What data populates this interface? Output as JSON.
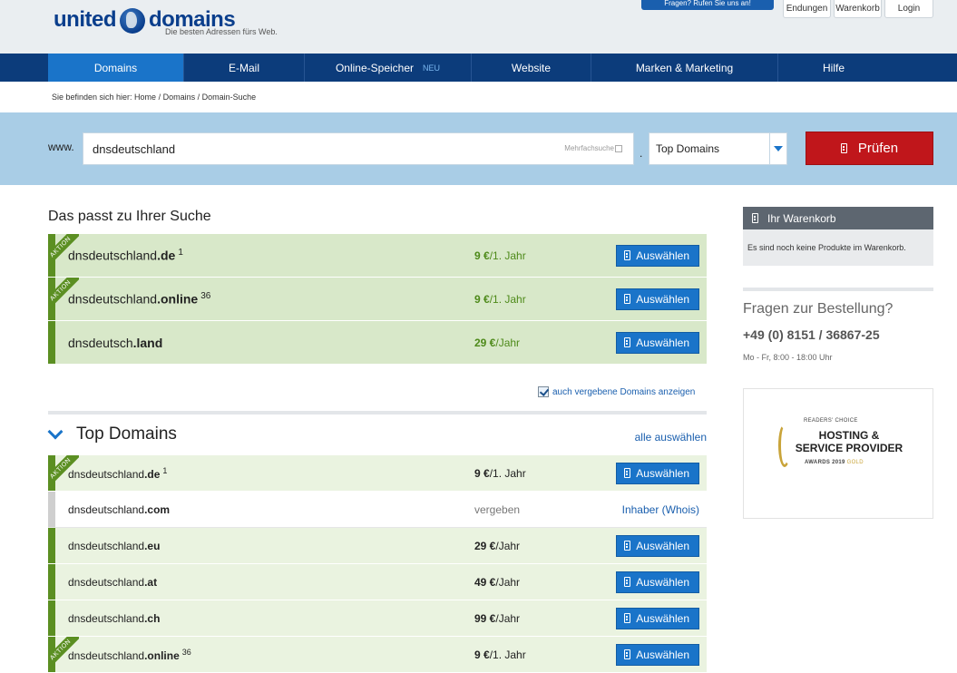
{
  "header": {
    "logo_left": "united",
    "logo_right": "domains",
    "tagline": "Die besten Adressen fürs Web.",
    "promo_text": "Fragen? Rufen Sie uns an!",
    "buttons": {
      "endungen": "Endungen",
      "warenkorb": "Warenkorb",
      "login": "Login"
    }
  },
  "nav": {
    "items": [
      {
        "label": "Domains"
      },
      {
        "label": "E-Mail"
      },
      {
        "label": "Online-Speicher",
        "badge": "NEU"
      },
      {
        "label": "Website"
      },
      {
        "label": "Marken & Marketing"
      },
      {
        "label": "Hilfe"
      }
    ]
  },
  "breadcrumb": "Sie befinden sich hier: Home / Domains / Domain-Suche",
  "search": {
    "prefix": "www.",
    "value": "dnsdeutschland",
    "multi_label": "Mehrfachsuche",
    "dot": ".",
    "tld_select": "Top Domains",
    "submit_label": "Prüfen"
  },
  "matches": {
    "heading": "Das passt zu Ihrer Suche",
    "aktion_label": "AKTION",
    "select_label": "Auswählen",
    "rows": [
      {
        "sld": "dnsdeutschland",
        "tld": ".de",
        "note": "1",
        "price": "9 €",
        "unit": "/1. Jahr"
      },
      {
        "sld": "dnsdeutschland",
        "tld": ".online",
        "note": "36",
        "price": "9 €",
        "unit": "/1. Jahr"
      },
      {
        "sld": "dnsdeutsch",
        "tld": ".land",
        "note": "",
        "price": "29 €",
        "unit": "/Jahr"
      }
    ]
  },
  "show_taken_label": "auch vergebene Domains anzeigen",
  "top_domains": {
    "title": "Top Domains",
    "select_all": "alle auswählen",
    "select_label": "Auswählen",
    "whois_label": "Inhaber (Whois)",
    "rows": [
      {
        "sld": "dnsdeutschland",
        "tld": ".de",
        "note": "1",
        "price": "9 €",
        "unit": "/1. Jahr"
      },
      {
        "sld": "dnsdeutschland",
        "tld": ".com",
        "note": "",
        "status": "vergeben"
      },
      {
        "sld": "dnsdeutschland",
        "tld": ".eu",
        "note": "",
        "price": "29 €",
        "unit": "/Jahr"
      },
      {
        "sld": "dnsdeutschland",
        "tld": ".at",
        "note": "",
        "price": "49 €",
        "unit": "/Jahr"
      },
      {
        "sld": "dnsdeutschland",
        "tld": ".ch",
        "note": "",
        "price": "99 €",
        "unit": "/Jahr"
      },
      {
        "sld": "dnsdeutschland",
        "tld": ".online",
        "note": "36",
        "price": "9 €",
        "unit": "/1. Jahr"
      }
    ]
  },
  "sidebar": {
    "cart_title": "Ihr Warenkorb",
    "cart_empty": "Es sind noch keine Produkte im Warenkorb.",
    "faq_title": "Fragen zur Bestellung?",
    "phone": "+49 (0) 8151 / 36867-25",
    "hours": "Mo - Fr, 8:00 - 18:00 Uhr",
    "award": {
      "readers_choice": "READERS' CHOICE",
      "line1": "HOSTING &",
      "line2": "SERVICE PROVIDER",
      "year": "AWARDS 2019",
      "level": "GOLD"
    }
  },
  "colors": {
    "nav_bg": "#0c3c7b",
    "nav_active": "#1a74c9",
    "accent_green": "#5b8f22",
    "submit_red": "#c0161b"
  }
}
